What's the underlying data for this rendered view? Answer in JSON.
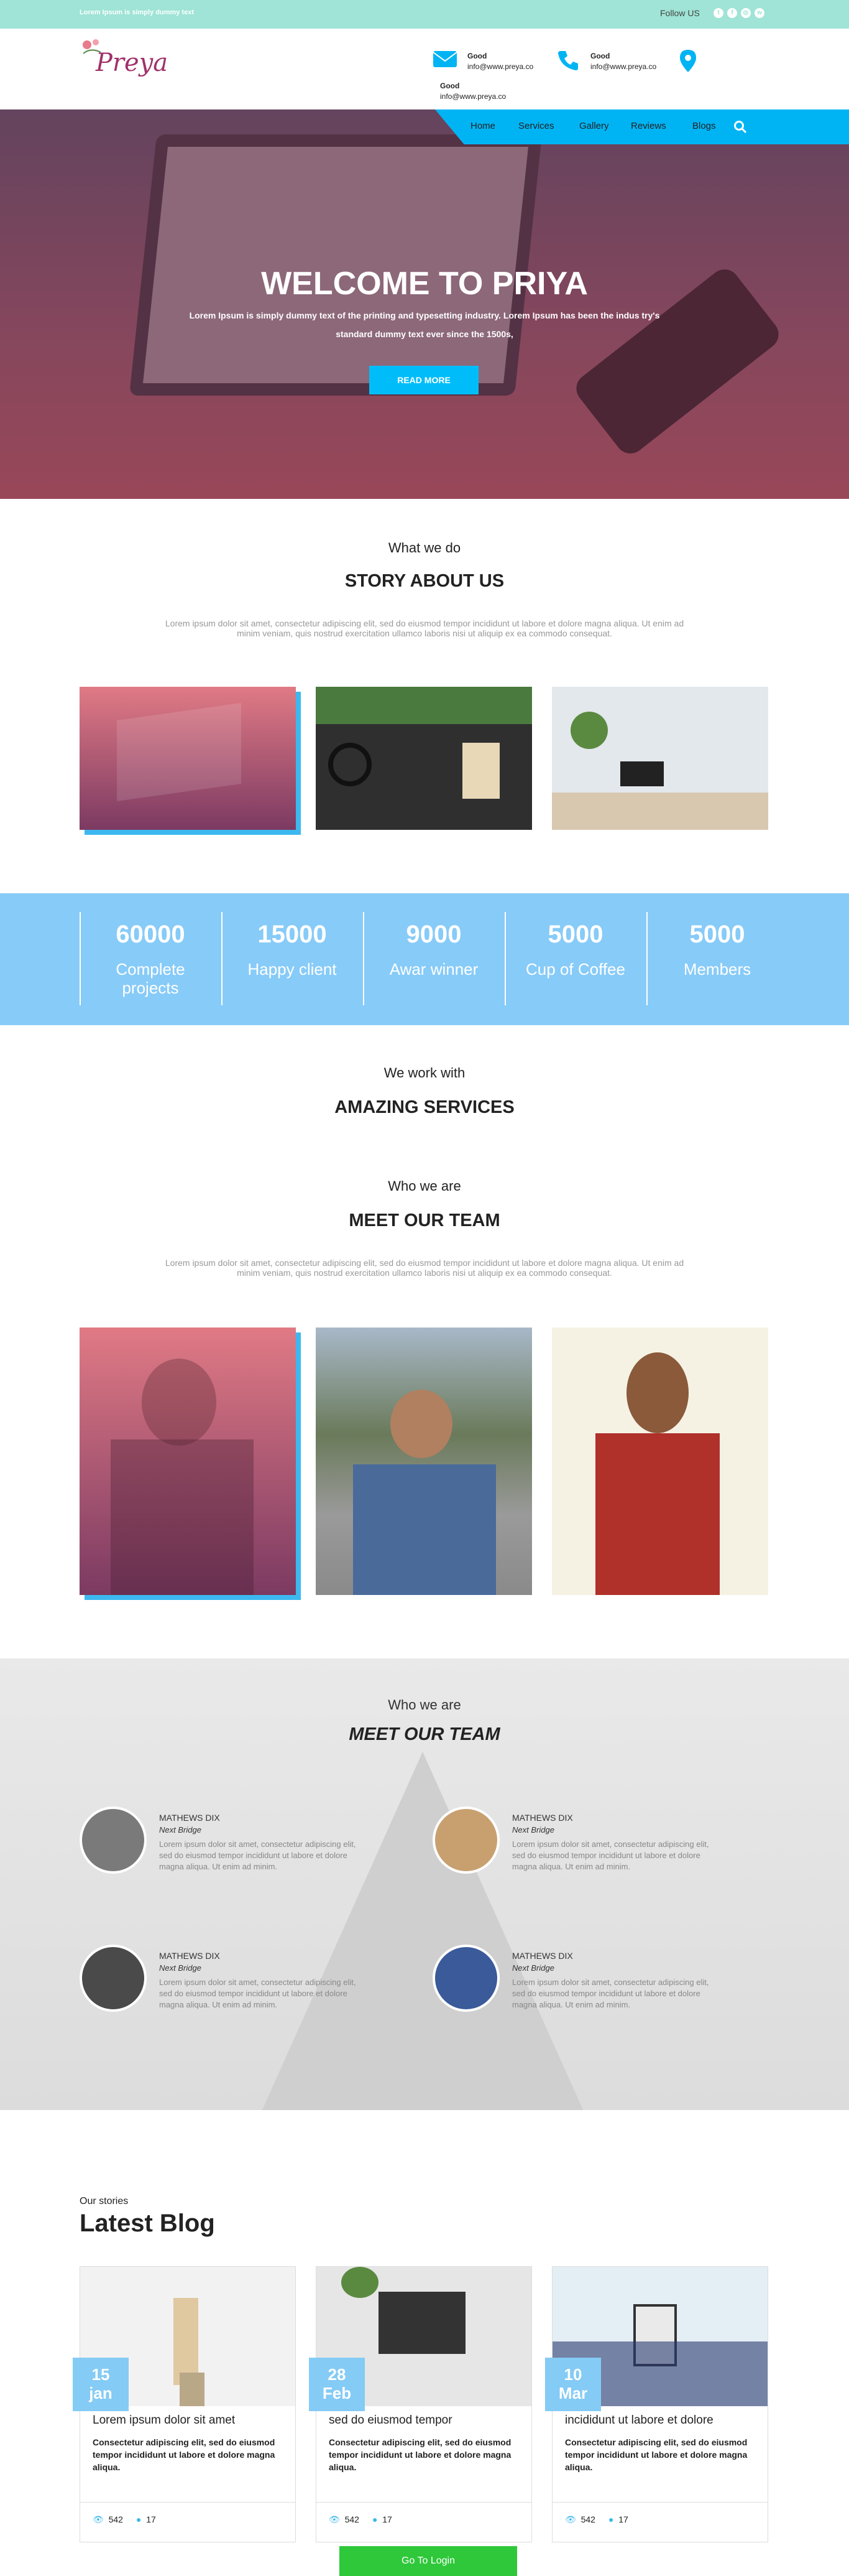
{
  "topbar": {
    "left_text": "Lorem Ipsum is simply dummy text",
    "follow": "Follow US"
  },
  "header": {
    "logo": "Preya",
    "contacts": [
      {
        "title": "Good",
        "email": "info@www.preya.co"
      },
      {
        "title": "Good",
        "email": "info@www.preya.co"
      },
      {
        "title": "Good",
        "email": "info@www.preya.co"
      }
    ]
  },
  "nav": {
    "items": [
      "Home",
      "Services",
      "Gallery",
      "Reviews",
      "Blogs"
    ]
  },
  "hero": {
    "title": "WELCOME TO PRIYA",
    "text": "Lorem Ipsum is simply dummy text of the printing and typesetting industry. Lorem Ipsum has been the indus try's standard dummy text ever since the 1500s,",
    "button": "READ MORE"
  },
  "story": {
    "sub": "What we do",
    "title": "STORY ABOUT US",
    "text": "Lorem ipsum dolor sit amet, consectetur adipiscing elit, sed do eiusmod tempor incididunt ut labore et dolore magna aliqua. Ut enim ad minim veniam, quis nostrud exercitation ullamco laboris nisi ut aliquip ex ea commodo consequat."
  },
  "stats": [
    {
      "number": "60000",
      "label": "Complete projects"
    },
    {
      "number": "15000",
      "label": "Happy client"
    },
    {
      "number": "9000",
      "label": "Awar winner"
    },
    {
      "number": "5000",
      "label": "Cup of Coffee"
    },
    {
      "number": "5000",
      "label": "Members"
    }
  ],
  "services": {
    "sub": "We work with",
    "title": "AMAZING SERVICES"
  },
  "team": {
    "sub": "Who we are",
    "title": "MEET OUR TEAM",
    "text": "Lorem ipsum dolor sit amet, consectetur adipiscing elit, sed do eiusmod tempor incididunt ut labore et dolore magna aliqua. Ut enim ad minim veniam, quis nostrud exercitation ullamco laboris nisi ut aliquip ex ea commodo consequat."
  },
  "team2": {
    "sub": "Who we are",
    "title": "MEET OUR TEAM",
    "members": [
      {
        "name": "MATHEWS DIX",
        "role": "Next Bridge",
        "desc": "Lorem ipsum dolor sit amet, consectetur adipiscing elit, sed do eiusmod tempor incididunt ut labore et dolore magna aliqua. Ut enim ad minim."
      },
      {
        "name": "MATHEWS DIX",
        "role": "Next Bridge",
        "desc": "Lorem ipsum dolor sit amet, consectetur adipiscing elit, sed do eiusmod tempor incididunt ut labore et dolore magna aliqua. Ut enim ad minim."
      },
      {
        "name": "MATHEWS DIX",
        "role": "Next Bridge",
        "desc": "Lorem ipsum dolor sit amet, consectetur adipiscing elit, sed do eiusmod tempor incididunt ut labore et dolore magna aliqua. Ut enim ad minim."
      },
      {
        "name": "MATHEWS DIX",
        "role": "Next Bridge",
        "desc": "Lorem ipsum dolor sit amet, consectetur adipiscing elit, sed do eiusmod tempor incididunt ut labore et dolore magna aliqua. Ut enim ad minim."
      }
    ]
  },
  "blog": {
    "sub": "Our stories",
    "title": "Latest Blog",
    "posts": [
      {
        "day": "15",
        "month": "jan",
        "title": "Lorem ipsum dolor sit amet",
        "body": "Consectetur adipiscing elit, sed do eiusmod tempor incididunt ut labore et dolore magna aliqua.",
        "views": "542",
        "comments": "17"
      },
      {
        "day": "28",
        "month": "Feb",
        "title": "sed do eiusmod tempor",
        "body": "Consectetur adipiscing elit, sed do eiusmod tempor incididunt ut labore et dolore magna aliqua.",
        "views": "542",
        "comments": "17"
      },
      {
        "day": "10",
        "month": "Mar",
        "title": "incididunt ut labore et dolore",
        "body": "Consectetur adipiscing elit, sed do eiusmod tempor incididunt ut labore et dolore magna aliqua.",
        "views": "542",
        "comments": "17"
      }
    ]
  },
  "footer": {
    "button": "Go To Login"
  }
}
